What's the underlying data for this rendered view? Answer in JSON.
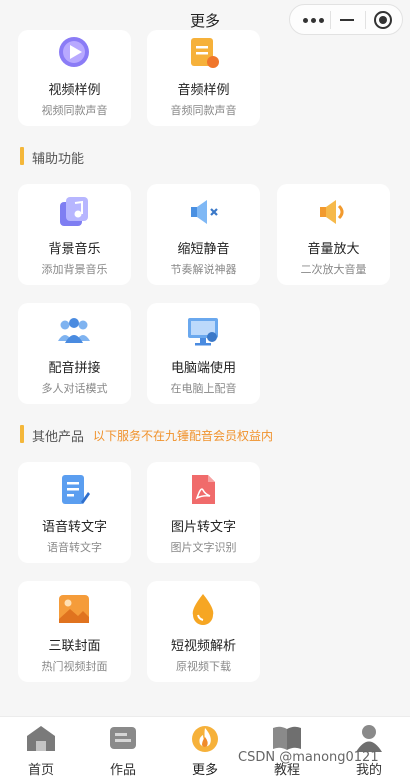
{
  "header": {
    "title": "更多"
  },
  "top_cards": [
    {
      "title": "视频样例",
      "sub": "视频同款声音",
      "icon": "video-play-icon"
    },
    {
      "title": "音频样例",
      "sub": "音频同款声音",
      "icon": "audio-doc-icon"
    }
  ],
  "sections": {
    "assist": {
      "label": "辅助功能"
    },
    "other": {
      "label": "其他产品",
      "note": "以下服务不在九锤配音会员权益内"
    }
  },
  "assist_cards": [
    {
      "title": "背景音乐",
      "sub": "添加背景音乐",
      "icon": "music-note-icon"
    },
    {
      "title": "缩短静音",
      "sub": "节奏解说神器",
      "icon": "speaker-mute-icon"
    },
    {
      "title": "音量放大",
      "sub": "二次放大音量",
      "icon": "speaker-loud-icon"
    },
    {
      "title": "配音拼接",
      "sub": "多人对话模式",
      "icon": "people-group-icon"
    },
    {
      "title": "电脑端使用",
      "sub": "在电脑上配音",
      "icon": "desktop-computer-icon"
    }
  ],
  "other_cards": [
    {
      "title": "语音转文字",
      "sub": "语音转文字",
      "icon": "doc-pen-icon"
    },
    {
      "title": "图片转文字",
      "sub": "图片文字识别",
      "icon": "pdf-doc-icon"
    },
    {
      "title": "三联封面",
      "sub": "热门视频封面",
      "icon": "image-icon"
    },
    {
      "title": "短视频解析",
      "sub": "原视频下载",
      "icon": "droplet-icon"
    }
  ],
  "tabbar": [
    {
      "label": "首页",
      "icon": "home-icon"
    },
    {
      "label": "作品",
      "icon": "works-card-icon"
    },
    {
      "label": "更多",
      "icon": "flame-icon",
      "active": true
    },
    {
      "label": "教程",
      "icon": "book-icon"
    },
    {
      "label": "我的",
      "icon": "user-icon"
    }
  ],
  "watermark": "CSDN @manong0121",
  "colors": {
    "accent": "#f4b73a",
    "note": "#f0922c",
    "bg": "#f6f6f6"
  }
}
